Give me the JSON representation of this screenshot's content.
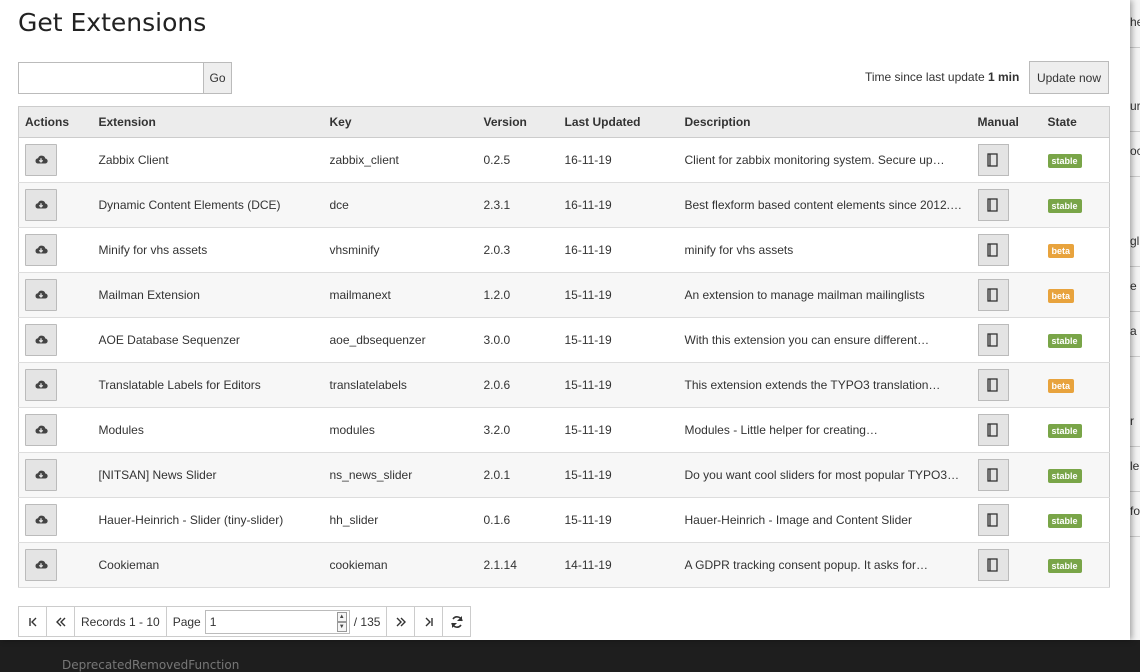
{
  "page": {
    "title": "Get Extensions",
    "search_placeholder": "",
    "go_label": "Go",
    "update_text": "Time since last update",
    "update_value": "1 min",
    "update_button": "Update now"
  },
  "table": {
    "columns": [
      "Actions",
      "Extension",
      "Key",
      "Version",
      "Last Updated",
      "Description",
      "Manual",
      "State"
    ],
    "rows": [
      {
        "name": "Zabbix Client",
        "key": "zabbix_client",
        "version": "0.2.5",
        "updated": "16-11-19",
        "description": "Client for zabbix monitoring system. Secure up…",
        "state": "stable"
      },
      {
        "name": "Dynamic Content Elements (DCE)",
        "key": "dce",
        "version": "2.3.1",
        "updated": "16-11-19",
        "description": "Best flexform based content elements since 2012.…",
        "state": "stable"
      },
      {
        "name": "Minify for vhs assets",
        "key": "vhsminify",
        "version": "2.0.3",
        "updated": "16-11-19",
        "description": "minify for vhs assets",
        "state": "beta"
      },
      {
        "name": "Mailman Extension",
        "key": "mailmanext",
        "version": "1.2.0",
        "updated": "15-11-19",
        "description": "An extension to manage mailman mailinglists",
        "state": "beta"
      },
      {
        "name": "AOE Database Sequenzer",
        "key": "aoe_dbsequenzer",
        "version": "3.0.0",
        "updated": "15-11-19",
        "description": "With this extension you can ensure different…",
        "state": "stable"
      },
      {
        "name": "Translatable Labels for Editors",
        "key": "translatelabels",
        "version": "2.0.6",
        "updated": "15-11-19",
        "description": "This extension extends the TYPO3 translation…",
        "state": "beta"
      },
      {
        "name": "Modules",
        "key": "modules",
        "version": "3.2.0",
        "updated": "15-11-19",
        "description": "Modules - Little helper for creating…",
        "state": "stable"
      },
      {
        "name": "[NITSAN] News Slider",
        "key": "ns_news_slider",
        "version": "2.0.1",
        "updated": "15-11-19",
        "description": "Do you want cool sliders for most popular TYPO3…",
        "state": "stable"
      },
      {
        "name": "Hauer-Heinrich - Slider (tiny-slider)",
        "key": "hh_slider",
        "version": "0.1.6",
        "updated": "15-11-19",
        "description": "Hauer-Heinrich - Image and Content Slider",
        "state": "stable"
      },
      {
        "name": "Cookieman",
        "key": "cookieman",
        "version": "2.1.14",
        "updated": "14-11-19",
        "description": "A GDPR tracking consent popup. It asks for…",
        "state": "stable"
      }
    ]
  },
  "pagination": {
    "records": "Records 1 - 10",
    "page_label": "Page",
    "page_value": "1",
    "total": "/ 135"
  },
  "background": {
    "bottom_text": "DeprecatedRemovedFunction",
    "side_fragments": [
      "he",
      "ur",
      "oc",
      "gl",
      "e",
      "a",
      "r",
      "le",
      "fo"
    ]
  },
  "colors": {
    "stable": "#79a548",
    "beta": "#e8a33d"
  }
}
